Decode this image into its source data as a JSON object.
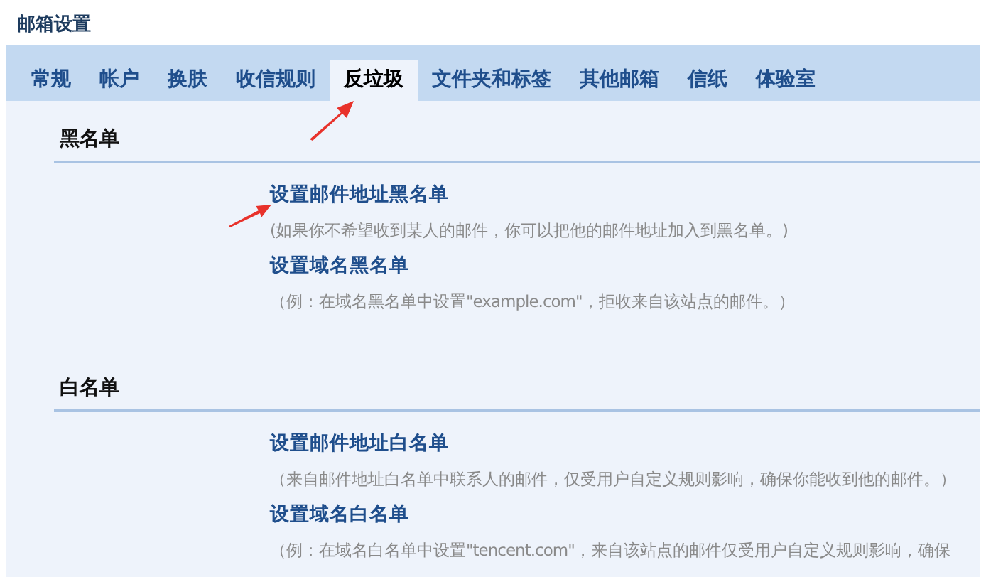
{
  "page_title": "邮箱设置",
  "tabs": [
    {
      "label": "常规",
      "selected": false
    },
    {
      "label": "帐户",
      "selected": false
    },
    {
      "label": "换肤",
      "selected": false
    },
    {
      "label": "收信规则",
      "selected": false
    },
    {
      "label": "反垃圾",
      "selected": true
    },
    {
      "label": "文件夹和标签",
      "selected": false
    },
    {
      "label": "其他邮箱",
      "selected": false
    },
    {
      "label": "信纸",
      "selected": false
    },
    {
      "label": "体验室",
      "selected": false
    }
  ],
  "sections": [
    {
      "heading": "黑名单",
      "items": [
        {
          "link": "设置邮件地址黑名单",
          "description": "(如果你不希望收到某人的邮件，你可以把他的邮件地址加入到黑名单。)"
        },
        {
          "link": "设置域名黑名单",
          "description": "（例：在域名黑名单中设置\"example.com\"，拒收来自该站点的邮件。）"
        }
      ]
    },
    {
      "heading": "白名单",
      "items": [
        {
          "link": "设置邮件地址白名单",
          "description": "（来自邮件地址白名单中联系人的邮件，仅受用户自定义规则影响，确保你能收到他的邮件。）"
        },
        {
          "link": "设置域名白名单",
          "description": "（例：在域名白名单中设置\"tencent.com\"，来自该站点的邮件仅受用户自定义规则影响，确保"
        }
      ]
    }
  ]
}
